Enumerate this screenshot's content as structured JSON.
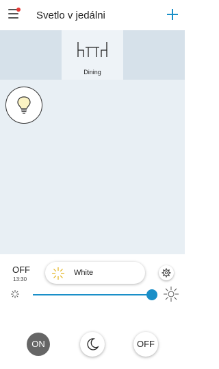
{
  "header": {
    "title": "Svetlo v jedálni",
    "menu_icon": "menu-icon",
    "add_icon": "plus-icon",
    "notification_color": "#e53935"
  },
  "rooms": [
    {
      "label": "Dining",
      "icon": "dining-table-icon",
      "selected": true
    }
  ],
  "lights": [
    {
      "icon": "bulb-icon",
      "state": "off"
    }
  ],
  "status": {
    "label": "OFF",
    "time": "13:30"
  },
  "mode": {
    "label": "White",
    "icon": "sun-icon"
  },
  "brightness": {
    "value": 1.0,
    "accent": "#1a8fc8"
  },
  "controls": {
    "on_label": "ON",
    "off_label": "OFF",
    "night_icon": "moon-icon"
  }
}
